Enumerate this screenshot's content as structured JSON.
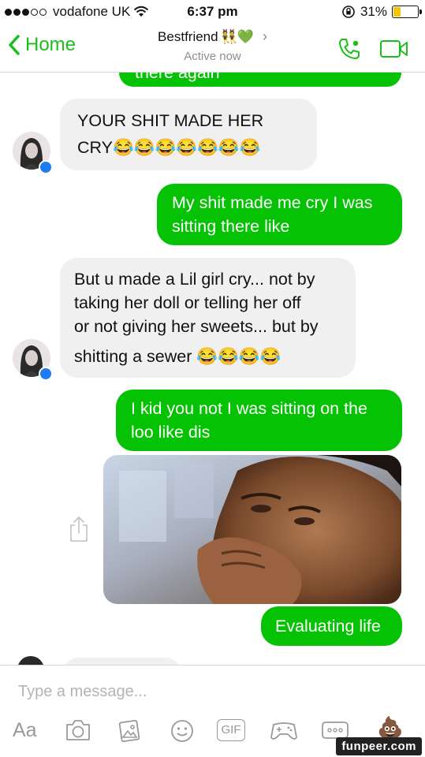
{
  "status_bar": {
    "carrier": "vodafone UK",
    "time": "6:37 pm",
    "battery": "31%",
    "battery_level": 0.31
  },
  "nav": {
    "back_label": "Home",
    "contact_name": "Bestfriend",
    "contact_emoji": "👯💚",
    "status": "Active now",
    "accent": "#1bbf1b"
  },
  "messages": [
    {
      "side": "outgoing",
      "text": "there again"
    },
    {
      "side": "incoming",
      "lines": [
        "YOUR SHIT MADE HER",
        "CRY😂😂😂😂😂😂😂"
      ]
    },
    {
      "side": "outgoing",
      "lines": [
        "My shit made me cry I was",
        "sitting there like"
      ]
    },
    {
      "side": "incoming",
      "lines": [
        "But u made a Lil girl cry... not by",
        "taking her doll or telling her off",
        "or not giving her sweets... but by",
        "shitting a sewer 😂😂😂😂"
      ]
    },
    {
      "side": "outgoing",
      "lines": [
        "I kid you not I was sitting on the",
        "loo like dis"
      ]
    },
    {
      "side": "outgoing",
      "type": "photo",
      "alt": "crying man photo"
    },
    {
      "side": "outgoing",
      "text": "Evaluating life"
    }
  ],
  "composer": {
    "placeholder": "Type a message...",
    "aa_label": "Aa",
    "gif_label": "GIF",
    "poop_emoji": "💩"
  },
  "colors": {
    "outgoing_bubble": "#05c205",
    "incoming_bubble": "#f1f0f0",
    "messenger_badge": "#1e7bf2"
  },
  "watermark": "funpeer.com"
}
